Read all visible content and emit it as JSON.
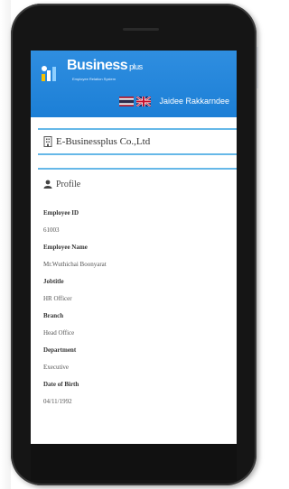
{
  "app": {
    "brand_main": "Business",
    "brand_small": "plus",
    "tagline": "Employee Relation System",
    "colors": {
      "header_blue": "#1c7fd6",
      "accent_line": "#66b8e8"
    }
  },
  "header": {
    "flags": [
      {
        "icon": "thailand-flag-icon"
      },
      {
        "icon": "uk-flag-icon"
      }
    ],
    "user_name": "Jaidee Rakkarndee"
  },
  "company": {
    "icon": "building-icon",
    "name": "E-Businessplus Co.,Ltd"
  },
  "profile": {
    "icon": "user-icon",
    "title": "Profile",
    "fields": [
      {
        "label": "Employee ID",
        "value": "61003"
      },
      {
        "label": "Employee Name",
        "value": "Mr.Wuthichai Boonyarat"
      },
      {
        "label": "Jobtitle",
        "value": "HR Officer"
      },
      {
        "label": "Branch",
        "value": "Head Office"
      },
      {
        "label": "Department",
        "value": "Executive"
      },
      {
        "label": "Date of Birth",
        "value": "04/11/1992"
      }
    ]
  }
}
